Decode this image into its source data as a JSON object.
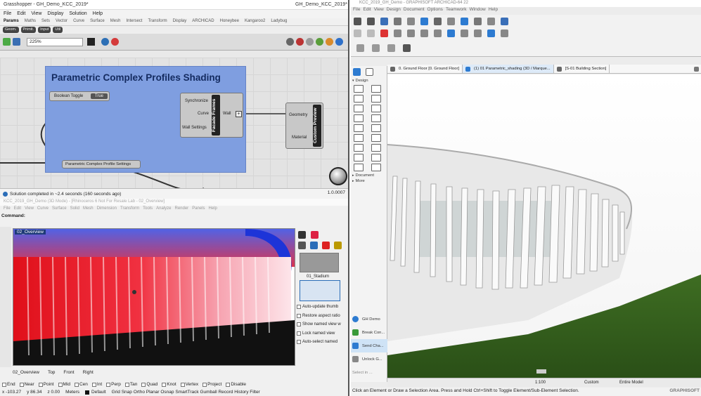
{
  "grasshopper": {
    "title": "Grasshopper - GH_Demo_KCC_2019*",
    "doc_name": "GH_Demo_KCC_2019*",
    "menu": [
      "File",
      "Edit",
      "View",
      "Display",
      "Solution",
      "Help"
    ],
    "tabs": [
      "Params",
      "Maths",
      "Sets",
      "Vector",
      "Curve",
      "Surface",
      "Mesh",
      "Intersect",
      "Transform",
      "Display",
      "ARCHICAD",
      "Honeybee",
      "Kangaroo2",
      "Ladybug"
    ],
    "subtabs": [
      "Geom.",
      "Primit.",
      "Input",
      "Util"
    ],
    "zoom": "225%",
    "group_title": "Parametric Complex Profiles Shading",
    "nodes": {
      "boolean_toggle": "Boolean Toggle",
      "toggle_value": "True",
      "facade_frames": "Facade Frames",
      "inputs": [
        "Synchronize",
        "Curve",
        "Wall Settings"
      ],
      "output": "Wall",
      "plus": "+",
      "custom_preview": "Custom Preview",
      "preview_inputs": [
        "Geometry",
        "Material"
      ],
      "profile_settings": "Parametric Complex Profile Settings"
    },
    "status": "Solution completed in ~2.4 seconds (160 seconds ago)",
    "version": "1.0.0007"
  },
  "rhino": {
    "title": "KCC_2019_GH_Demo (3D Mode) - [Rhinoceros 6 Not For Resale Lab - 02_Overview]",
    "menu": [
      "File",
      "Edit",
      "View",
      "Curve",
      "Surface",
      "Solid",
      "Mesh",
      "Dimension",
      "Transform",
      "Tools",
      "Analyze",
      "Render",
      "Panels",
      "Help"
    ],
    "command_label": "Command:",
    "viewport_label": "02_Overview",
    "named_view_1": "01_Stadium",
    "options": [
      "Auto-update thumb",
      "Restore aspect ratio",
      "Show named view w",
      "Lock named view",
      "Auto-select named"
    ],
    "viewport_tabs": [
      "02_Overview",
      "Top",
      "Front",
      "Right"
    ],
    "osnaps": [
      "End",
      "Near",
      "Point",
      "Mid",
      "Cen",
      "Int",
      "Perp",
      "Tan",
      "Quad",
      "Knot",
      "Vertex",
      "Project",
      "Disable"
    ],
    "status": {
      "x": "x -103.27",
      "y": "y 86.34",
      "z": "z 0.00",
      "units": "Meters",
      "layer": "Default",
      "modes": "Grid Snap Ortho Planar Osnap SmartTrack Gumball Record History Filter"
    }
  },
  "archicad": {
    "title": "KCC_2019_GH_Demo - GRAPHISOFT ARCHICAD-64 22",
    "menu": [
      "File",
      "Edit",
      "View",
      "Design",
      "Document",
      "Options",
      "Teamwork",
      "Window",
      "Help"
    ],
    "view_tabs": [
      "0. Ground Floor [0. Ground Floor]",
      "(1) 01 Parametric_shading (3D / Marque...",
      "[S-01 Building Section]"
    ],
    "toolbox": {
      "design": "Design",
      "document": "Document",
      "more": "More"
    },
    "palette": [
      "GH Demo",
      "Break Con...",
      "Send Cha...",
      "Unlock G...",
      "Select in ..."
    ],
    "view_status": {
      "zoom": "1:100",
      "custom": "Custom",
      "model": "Entire Model"
    },
    "hint": "Click an Element or Draw a Selection Area. Press and Hold Ctrl+Shift to Toggle Element/Sub-Element Selection.",
    "brand": "GRAPHISOFT"
  }
}
